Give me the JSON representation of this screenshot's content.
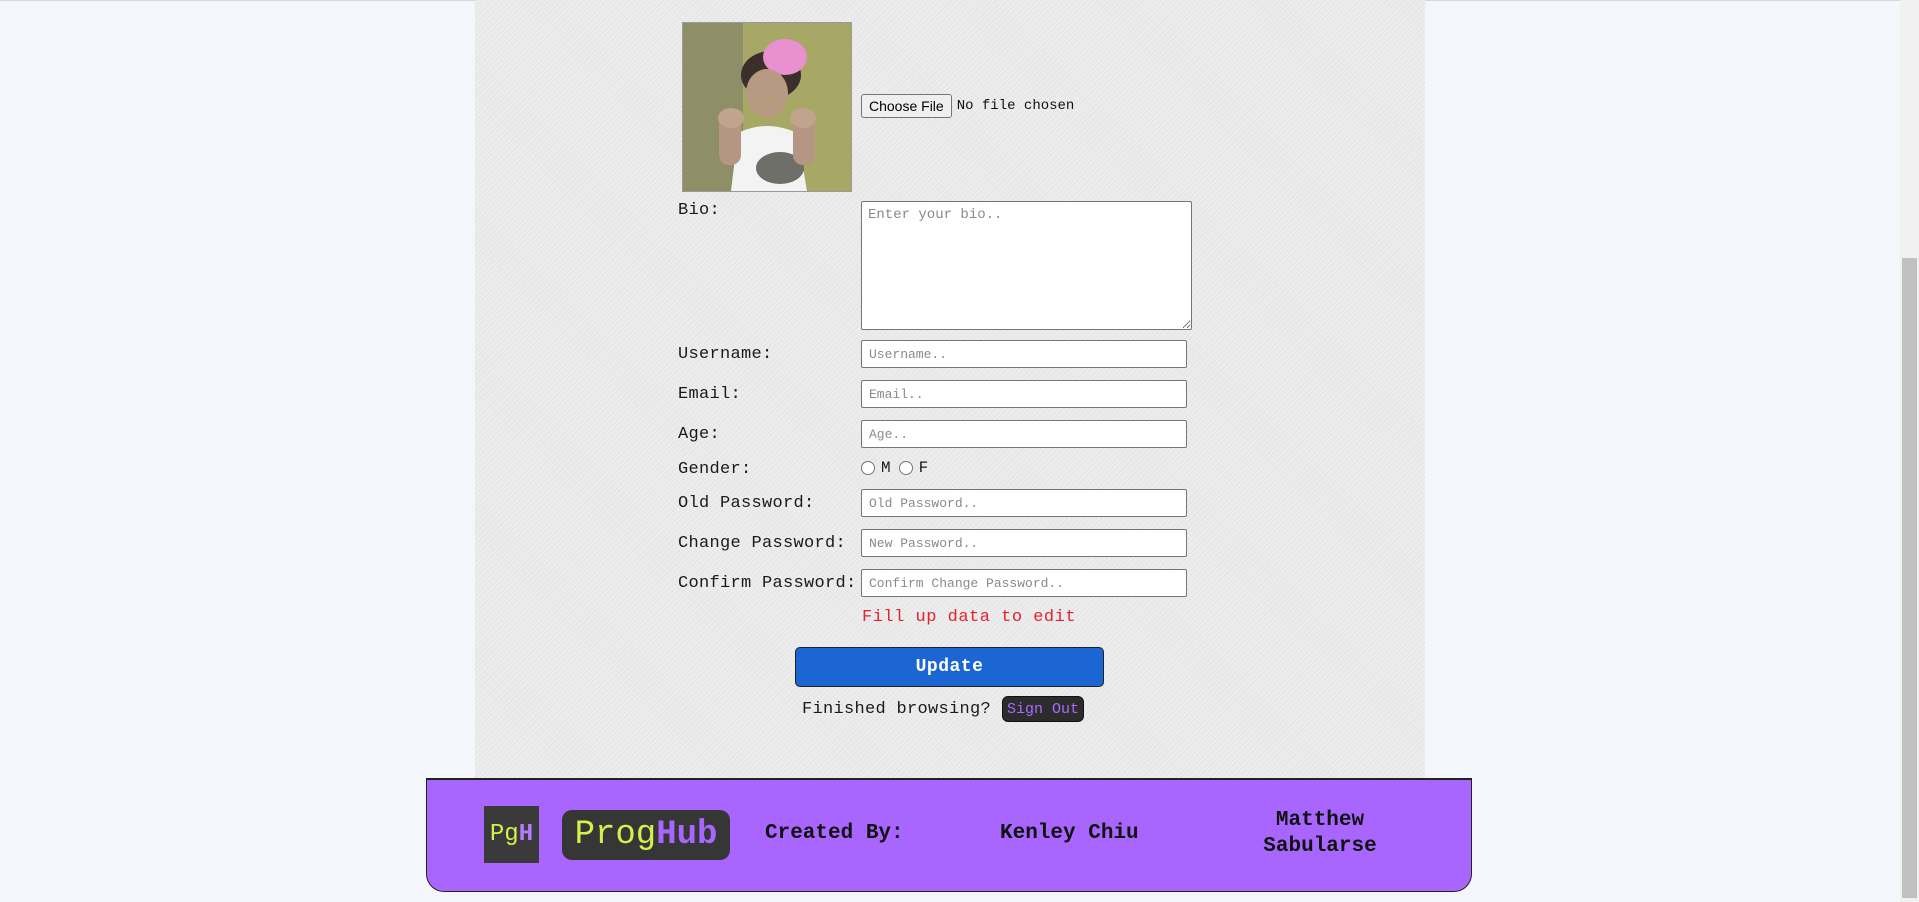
{
  "profile": {
    "file_button": "Choose File",
    "file_status": "No file chosen"
  },
  "form": {
    "bio": {
      "label": "Bio:",
      "placeholder": "Enter your bio.."
    },
    "username": {
      "label": "Username:",
      "placeholder": "Username.."
    },
    "email": {
      "label": "Email:",
      "placeholder": "Email.."
    },
    "age": {
      "label": "Age:",
      "placeholder": "Age.."
    },
    "gender": {
      "label": "Gender:",
      "options": [
        "M",
        "F"
      ]
    },
    "old_password": {
      "label": "Old Password:",
      "placeholder": "Old Password.."
    },
    "change_password": {
      "label": "Change Password:",
      "placeholder": "New Password.."
    },
    "confirm_password": {
      "label": "Confirm Password:",
      "placeholder": "Confirm Change Password.."
    },
    "error": "Fill up data to edit",
    "update_button": "Update"
  },
  "signout": {
    "prompt": "Finished browsing?",
    "button": "Sign Out"
  },
  "footer": {
    "logo_small_a": "Pg",
    "logo_small_b": "H",
    "logo_large_a": "Prog",
    "logo_large_b": "Hub",
    "created_by": "Created By:",
    "author_1": "Kenley Chiu",
    "author_2_line1": "Matthew",
    "author_2_line2": "Sabularse"
  },
  "colors": {
    "accent": "#a866ff",
    "button_blue": "#1b66d3",
    "error_red": "#e2232e",
    "logo_green": "#d7ef48"
  }
}
